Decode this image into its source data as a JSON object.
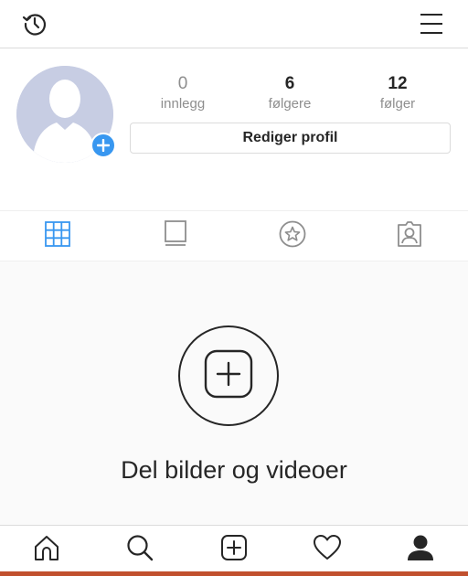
{
  "header": {
    "left_icon": "history-icon",
    "right_icon": "menu-icon"
  },
  "profile": {
    "stats": {
      "posts": {
        "count": "0",
        "label": "innlegg"
      },
      "followers": {
        "count": "6",
        "label": "følgere"
      },
      "following": {
        "count": "12",
        "label": "følger"
      }
    },
    "edit_label": "Rediger profil"
  },
  "tabs": {
    "active": "grid",
    "items": [
      "grid-icon",
      "feed-icon",
      "star-icon",
      "tagged-icon"
    ]
  },
  "empty_state": {
    "text": "Del bilder og videoer"
  },
  "bottom_nav": {
    "items": [
      "home-icon",
      "search-icon",
      "add-post-icon",
      "heart-icon",
      "profile-icon"
    ],
    "active": "profile"
  },
  "colors": {
    "accent": "#3897f0",
    "avatar_placeholder": "#c7cde3",
    "text": "#262626",
    "muted": "#8e8e8e",
    "bottom_strip": "#c1502e"
  }
}
